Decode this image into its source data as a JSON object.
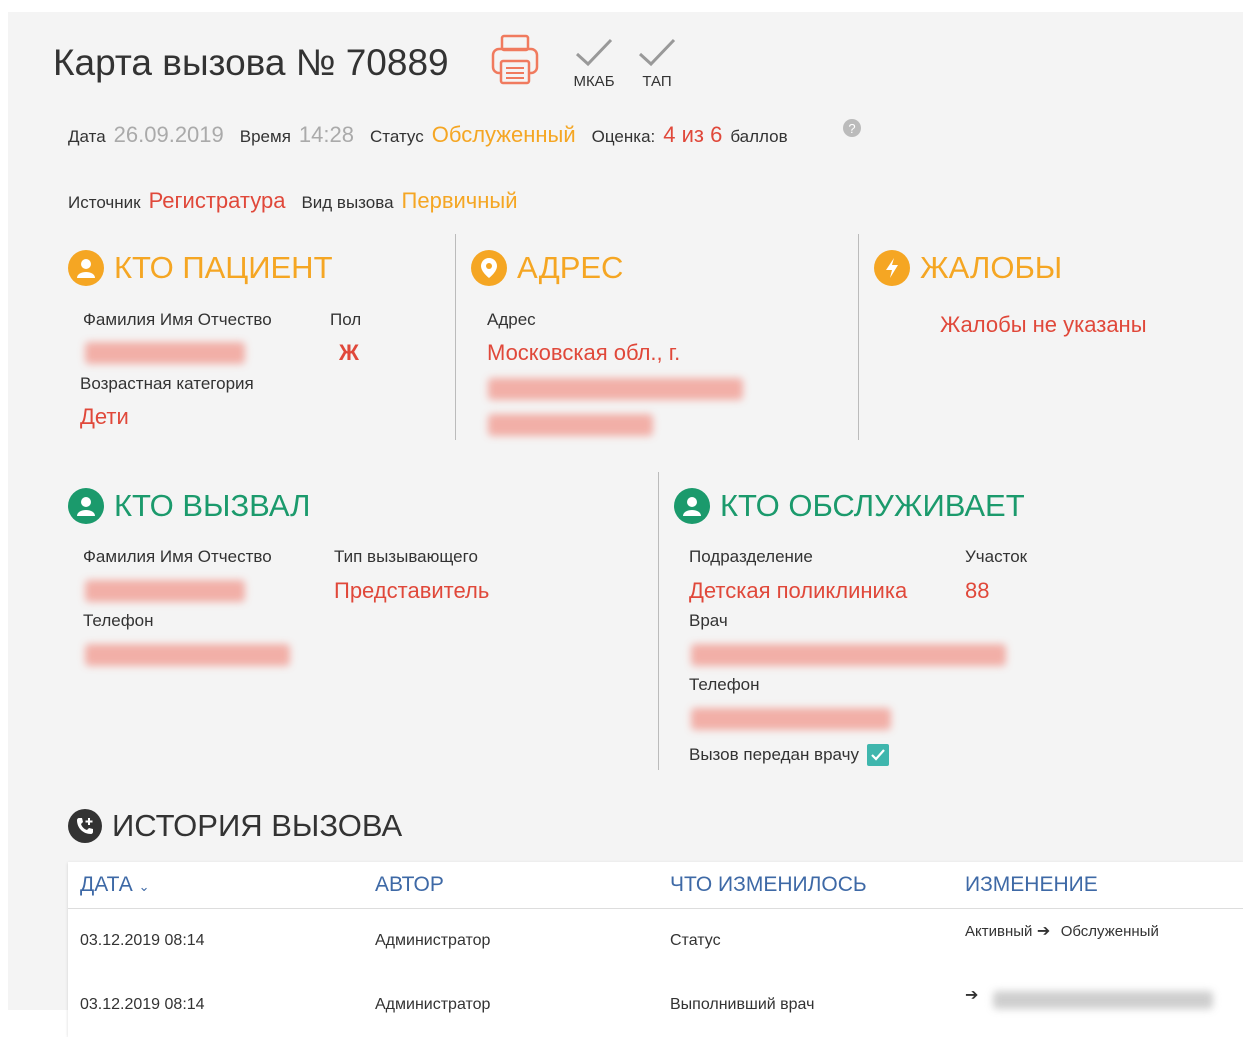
{
  "header": {
    "title": "Карта вызова № 70889",
    "mkab_label": "МКАБ",
    "tap_label": "ТАП"
  },
  "info": {
    "date_label": "Дата",
    "date_value": "26.09.2019",
    "time_label": "Время",
    "time_value": "14:28",
    "status_label": "Статус",
    "status_value": "Обслуженный",
    "rating_label": "Оценка:",
    "rating_value": "4 из 6",
    "rating_unit": "баллов",
    "source_label": "Источник",
    "source_value": "Регистратура",
    "call_type_label": "Вид вызова",
    "call_type_value": "Первичный"
  },
  "patient": {
    "title": "КТО ПАЦИЕНТ",
    "fio_label": "Фамилия Имя Отчество",
    "fio_value": "Тест Тест Тест",
    "sex_label": "Пол",
    "sex_value": "Ж",
    "age_label": "Возрастная категория",
    "age_value": "Дети"
  },
  "address": {
    "title": "АДРЕС",
    "label": "Адрес",
    "value": "Московская обл., г."
  },
  "complaints": {
    "title": "ЖАЛОБЫ",
    "value": "Жалобы не указаны"
  },
  "caller": {
    "title": "КТО ВЫЗВАЛ",
    "fio_label": "Фамилия Имя Отчество",
    "type_label": "Тип вызывающего",
    "type_value": "Представитель",
    "phone_label": "Телефон"
  },
  "service": {
    "title": "КТО ОБСЛУЖИВАЕТ",
    "division_label": "Подразделение",
    "division_value": "Детская поликлиника",
    "district_label": "Участок",
    "district_value": "88",
    "doctor_label": "Врач",
    "phone_label": "Телефон",
    "passed_label": "Вызов передан врачу",
    "passed_checked": true
  },
  "history": {
    "title": "ИСТОРИЯ ВЫЗОВА",
    "columns": [
      "ДАТА",
      "АВТОР",
      "ЧТО ИЗМЕНИЛОСЬ",
      "ИЗМЕНЕНИЕ"
    ],
    "rows": [
      {
        "date": "03.12.2019 08:14",
        "author": "Администратор",
        "what": "Статус",
        "from": "Активный",
        "to": "Обслуженный"
      },
      {
        "date": "03.12.2019 08:14",
        "author": "Администратор",
        "what": "Выполнивший врач",
        "from": "",
        "to": ""
      }
    ]
  },
  "colors": {
    "accent_red": "#e0483a",
    "accent_orange": "#f5a623",
    "accent_green": "#1b9a6c",
    "table_header": "#3e69a6"
  },
  "icons": [
    "printer-icon",
    "check-icon",
    "help-icon",
    "user-icon",
    "location-pin-icon",
    "lightning-icon",
    "phone-plus-icon",
    "sort-chevron-icon",
    "arrow-right-icon"
  ]
}
